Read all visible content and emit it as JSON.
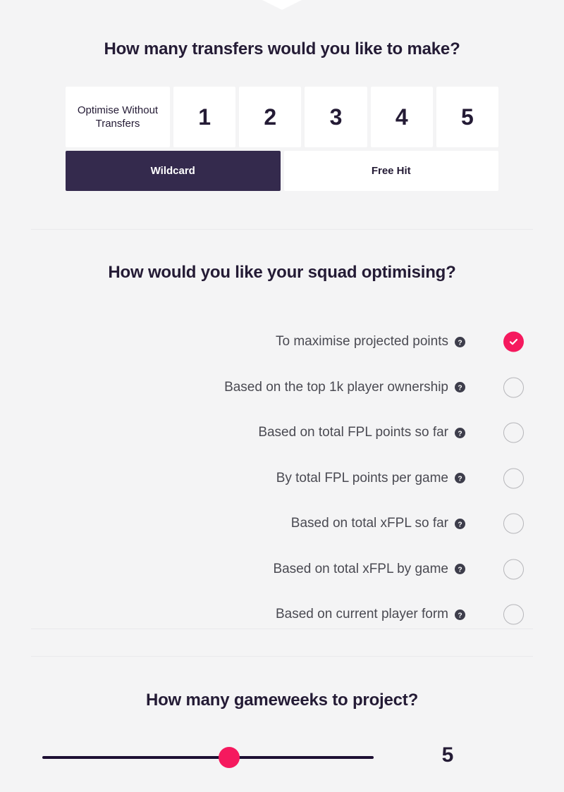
{
  "panel": {
    "notch_icon": "chevron-down-notch"
  },
  "transfers": {
    "heading": "How many transfers would you like to make?",
    "options": [
      {
        "label": "Optimise Without Transfers",
        "type": "wide",
        "selected": false
      },
      {
        "label": "1",
        "type": "num",
        "selected": false
      },
      {
        "label": "2",
        "type": "num",
        "selected": false
      },
      {
        "label": "3",
        "type": "num",
        "selected": false
      },
      {
        "label": "4",
        "type": "num",
        "selected": false
      },
      {
        "label": "5",
        "type": "num",
        "selected": false
      }
    ],
    "chips": [
      {
        "label": "Wildcard",
        "selected": true
      },
      {
        "label": "Free Hit",
        "selected": false
      }
    ]
  },
  "optimise": {
    "heading": "How would you like your squad optimising?",
    "help_icon": "question-mark-circle-icon",
    "selected_index": 0,
    "options": [
      {
        "label": "To maximise projected points",
        "selected": true
      },
      {
        "label": "Based on the top 1k player ownership",
        "selected": false
      },
      {
        "label": "Based on total FPL points so far",
        "selected": false
      },
      {
        "label": "By total FPL points per game",
        "selected": false
      },
      {
        "label": "Based on total xFPL so far",
        "selected": false
      },
      {
        "label": "Based on total xFPL by game",
        "selected": false
      },
      {
        "label": "Based on current player form",
        "selected": false
      }
    ]
  },
  "gameweeks": {
    "heading": "How many gameweeks to project?",
    "slider_value": "5",
    "slider_fill_percent": 53
  },
  "colors": {
    "background": "#f4f4f5",
    "heading": "#241b35",
    "accent_pink": "#f5195e",
    "selected_chip": "#342a4d",
    "card_white": "#ffffff",
    "body_text": "#4a4a52",
    "radio_border": "#b6b6ba",
    "divider": "#e9e9ec",
    "slider_track": "#1d0f33"
  }
}
